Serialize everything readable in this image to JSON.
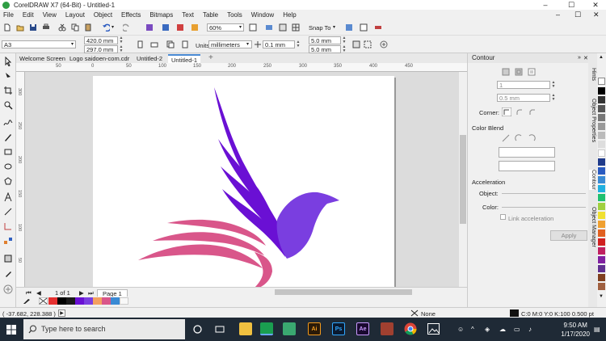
{
  "window": {
    "title": "CorelDRAW X7 (64-Bit) - Untitled-1",
    "minimize": "–",
    "maximize": "☐",
    "close": "✕"
  },
  "menu": [
    "File",
    "Edit",
    "View",
    "Layout",
    "Object",
    "Effects",
    "Bitmaps",
    "Text",
    "Table",
    "Tools",
    "Window",
    "Help"
  ],
  "toolbar": {
    "zoom": "60%",
    "snap_to": "Snap To"
  },
  "property_bar": {
    "page_size": "A3",
    "width": "420.0 mm",
    "height": "297.0 mm",
    "units_label": "Units:",
    "units": "millimeters",
    "nudge": "0.1 mm",
    "dup_x": "5.0 mm",
    "dup_y": "5.0 mm"
  },
  "tabs": [
    "Welcome Screen",
    "Logo saidoen-com.cdr",
    "Untitled-2",
    "Untitled-1"
  ],
  "ruler": {
    "h_ticks": [
      "50",
      "0",
      "50",
      "100",
      "150",
      "200",
      "250",
      "300",
      "350",
      "400",
      "450"
    ],
    "v_ticks": [
      "300",
      "250",
      "200",
      "150",
      "100",
      "50"
    ]
  },
  "page_nav": {
    "counter": "1 of 1",
    "page_tab": "Page 1"
  },
  "docker": {
    "title": "Contour",
    "steps": "1",
    "offset": "0.5 mm",
    "corner_label": "Corner:",
    "color_blend_label": "Color Blend",
    "acceleration_label": "Acceleration",
    "object_label": "Object:",
    "color_label": "Color:",
    "link_acceleration": "Link acceleration",
    "apply": "Apply"
  },
  "docker_tabs": [
    "Hints",
    "Object Properties",
    "Contour",
    "Object Manager"
  ],
  "status": {
    "coords": "( -37.682, 228.388 )",
    "fill": "None",
    "outline": "C:0 M:0 Y:0 K:100  0.500 pt"
  },
  "taskbar": {
    "search_placeholder": "Type here to search",
    "time": "9:50 AM",
    "date": "1/17/2020",
    "apps": [
      "Ai",
      "Ps",
      "Ae"
    ]
  },
  "colors": {
    "purple_dark": "#6a10d4",
    "purple_light": "#7a3ee0",
    "pink": "#d9568a",
    "accent": "#4a8ad4"
  }
}
